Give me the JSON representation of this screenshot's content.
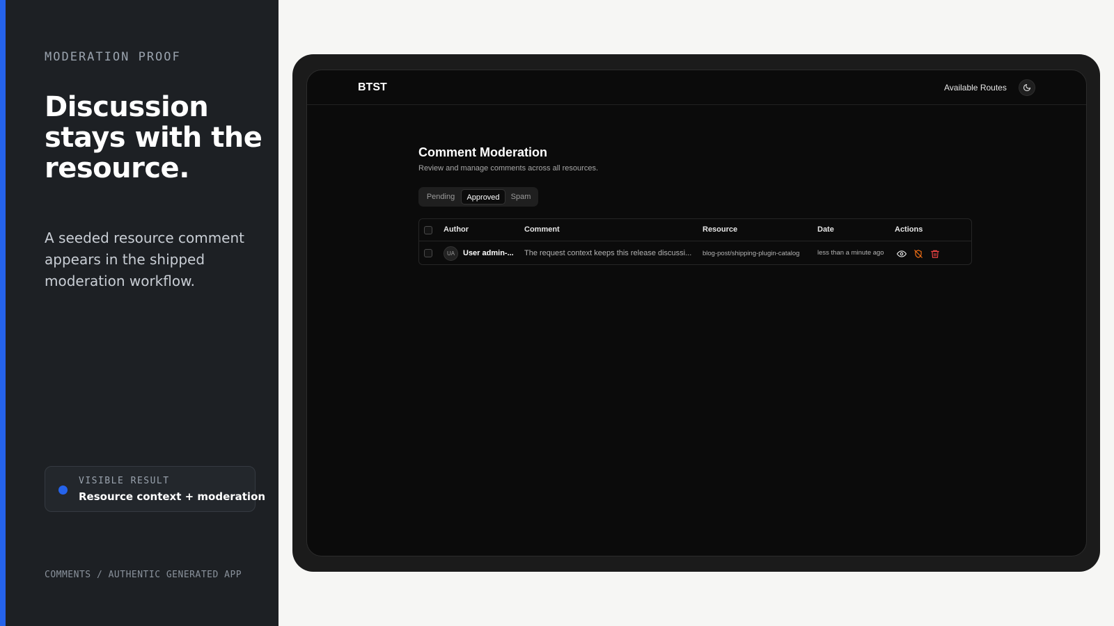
{
  "left": {
    "eyebrow": "MODERATION PROOF",
    "headline": "Discussion stays with the resource.",
    "description": "A seeded resource comment appears in the shipped moderation workflow.",
    "result": {
      "kicker": "VISIBLE RESULT",
      "title": "Resource context + moderation"
    },
    "footer": "COMMENTS / AUTHENTIC GENERATED APP"
  },
  "app": {
    "brand": "BTST",
    "nav": {
      "routes": "Available Routes",
      "theme_icon": "moon-icon"
    },
    "page": {
      "title": "Comment Moderation",
      "subtitle": "Review and manage comments across all resources."
    },
    "tabs": [
      {
        "label": "Pending",
        "active": false
      },
      {
        "label": "Approved",
        "active": true
      },
      {
        "label": "Spam",
        "active": false
      }
    ],
    "table": {
      "columns": [
        "Author",
        "Comment",
        "Resource",
        "Date",
        "Actions"
      ],
      "rows": [
        {
          "initials": "UA",
          "author": "User admin-...",
          "comment": "The request context keeps this release discussi...",
          "resource": "blog-post/shipping-plugin-catalog",
          "date": "less than a minute ago",
          "actions": [
            "eye-icon",
            "unapprove-icon",
            "trash-icon"
          ]
        }
      ]
    }
  },
  "colors": {
    "accent": "#2563eb",
    "left_bg": "#1d2024",
    "app_bg": "#0b0b0b",
    "danger": "#ef4444"
  }
}
